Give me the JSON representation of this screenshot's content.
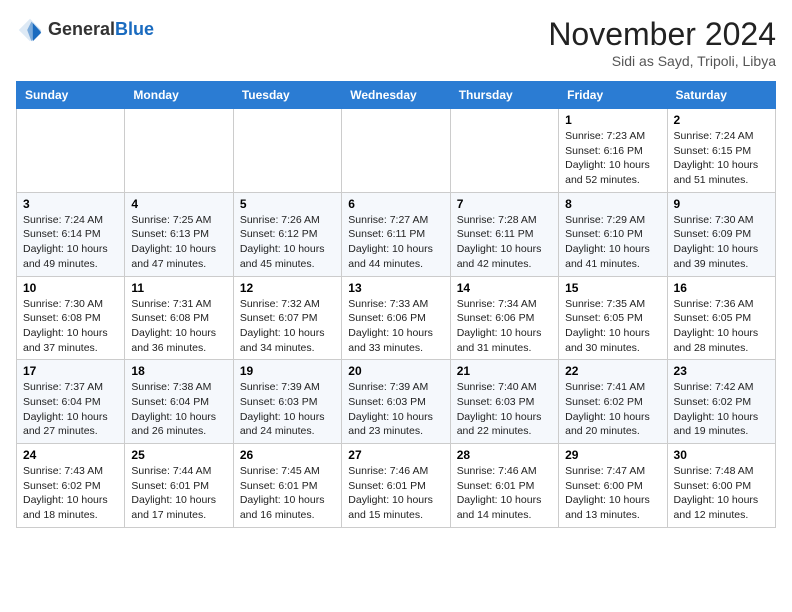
{
  "header": {
    "logo_line1": "General",
    "logo_line2": "Blue",
    "month_title": "November 2024",
    "location": "Sidi as Sayd, Tripoli, Libya"
  },
  "days_of_week": [
    "Sunday",
    "Monday",
    "Tuesday",
    "Wednesday",
    "Thursday",
    "Friday",
    "Saturday"
  ],
  "weeks": [
    [
      {
        "day": "",
        "info": ""
      },
      {
        "day": "",
        "info": ""
      },
      {
        "day": "",
        "info": ""
      },
      {
        "day": "",
        "info": ""
      },
      {
        "day": "",
        "info": ""
      },
      {
        "day": "1",
        "info": "Sunrise: 7:23 AM\nSunset: 6:16 PM\nDaylight: 10 hours and 52 minutes."
      },
      {
        "day": "2",
        "info": "Sunrise: 7:24 AM\nSunset: 6:15 PM\nDaylight: 10 hours and 51 minutes."
      }
    ],
    [
      {
        "day": "3",
        "info": "Sunrise: 7:24 AM\nSunset: 6:14 PM\nDaylight: 10 hours and 49 minutes."
      },
      {
        "day": "4",
        "info": "Sunrise: 7:25 AM\nSunset: 6:13 PM\nDaylight: 10 hours and 47 minutes."
      },
      {
        "day": "5",
        "info": "Sunrise: 7:26 AM\nSunset: 6:12 PM\nDaylight: 10 hours and 45 minutes."
      },
      {
        "day": "6",
        "info": "Sunrise: 7:27 AM\nSunset: 6:11 PM\nDaylight: 10 hours and 44 minutes."
      },
      {
        "day": "7",
        "info": "Sunrise: 7:28 AM\nSunset: 6:11 PM\nDaylight: 10 hours and 42 minutes."
      },
      {
        "day": "8",
        "info": "Sunrise: 7:29 AM\nSunset: 6:10 PM\nDaylight: 10 hours and 41 minutes."
      },
      {
        "day": "9",
        "info": "Sunrise: 7:30 AM\nSunset: 6:09 PM\nDaylight: 10 hours and 39 minutes."
      }
    ],
    [
      {
        "day": "10",
        "info": "Sunrise: 7:30 AM\nSunset: 6:08 PM\nDaylight: 10 hours and 37 minutes."
      },
      {
        "day": "11",
        "info": "Sunrise: 7:31 AM\nSunset: 6:08 PM\nDaylight: 10 hours and 36 minutes."
      },
      {
        "day": "12",
        "info": "Sunrise: 7:32 AM\nSunset: 6:07 PM\nDaylight: 10 hours and 34 minutes."
      },
      {
        "day": "13",
        "info": "Sunrise: 7:33 AM\nSunset: 6:06 PM\nDaylight: 10 hours and 33 minutes."
      },
      {
        "day": "14",
        "info": "Sunrise: 7:34 AM\nSunset: 6:06 PM\nDaylight: 10 hours and 31 minutes."
      },
      {
        "day": "15",
        "info": "Sunrise: 7:35 AM\nSunset: 6:05 PM\nDaylight: 10 hours and 30 minutes."
      },
      {
        "day": "16",
        "info": "Sunrise: 7:36 AM\nSunset: 6:05 PM\nDaylight: 10 hours and 28 minutes."
      }
    ],
    [
      {
        "day": "17",
        "info": "Sunrise: 7:37 AM\nSunset: 6:04 PM\nDaylight: 10 hours and 27 minutes."
      },
      {
        "day": "18",
        "info": "Sunrise: 7:38 AM\nSunset: 6:04 PM\nDaylight: 10 hours and 26 minutes."
      },
      {
        "day": "19",
        "info": "Sunrise: 7:39 AM\nSunset: 6:03 PM\nDaylight: 10 hours and 24 minutes."
      },
      {
        "day": "20",
        "info": "Sunrise: 7:39 AM\nSunset: 6:03 PM\nDaylight: 10 hours and 23 minutes."
      },
      {
        "day": "21",
        "info": "Sunrise: 7:40 AM\nSunset: 6:03 PM\nDaylight: 10 hours and 22 minutes."
      },
      {
        "day": "22",
        "info": "Sunrise: 7:41 AM\nSunset: 6:02 PM\nDaylight: 10 hours and 20 minutes."
      },
      {
        "day": "23",
        "info": "Sunrise: 7:42 AM\nSunset: 6:02 PM\nDaylight: 10 hours and 19 minutes."
      }
    ],
    [
      {
        "day": "24",
        "info": "Sunrise: 7:43 AM\nSunset: 6:02 PM\nDaylight: 10 hours and 18 minutes."
      },
      {
        "day": "25",
        "info": "Sunrise: 7:44 AM\nSunset: 6:01 PM\nDaylight: 10 hours and 17 minutes."
      },
      {
        "day": "26",
        "info": "Sunrise: 7:45 AM\nSunset: 6:01 PM\nDaylight: 10 hours and 16 minutes."
      },
      {
        "day": "27",
        "info": "Sunrise: 7:46 AM\nSunset: 6:01 PM\nDaylight: 10 hours and 15 minutes."
      },
      {
        "day": "28",
        "info": "Sunrise: 7:46 AM\nSunset: 6:01 PM\nDaylight: 10 hours and 14 minutes."
      },
      {
        "day": "29",
        "info": "Sunrise: 7:47 AM\nSunset: 6:00 PM\nDaylight: 10 hours and 13 minutes."
      },
      {
        "day": "30",
        "info": "Sunrise: 7:48 AM\nSunset: 6:00 PM\nDaylight: 10 hours and 12 minutes."
      }
    ]
  ]
}
